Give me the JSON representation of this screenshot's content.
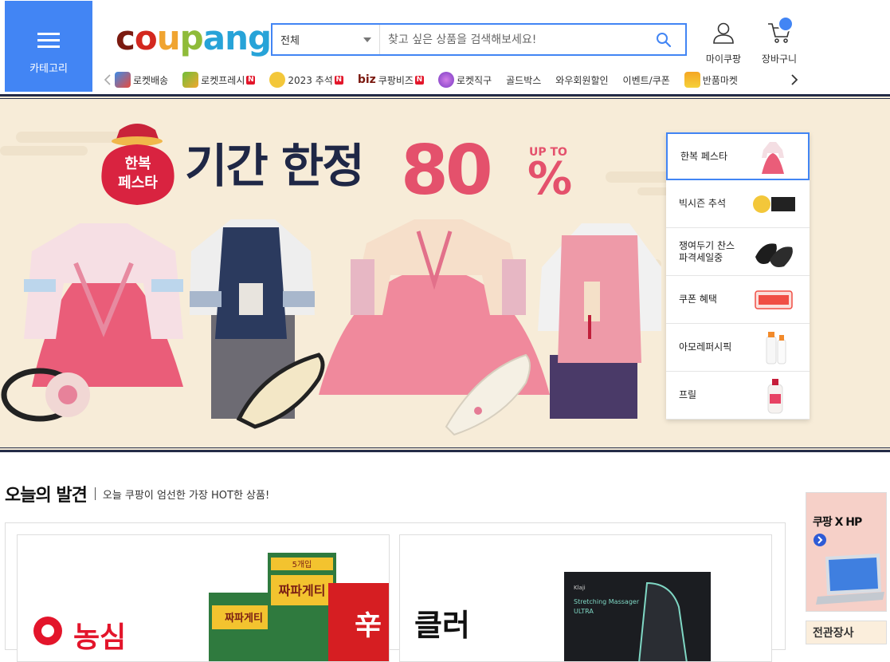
{
  "header": {
    "category_label": "카테고리",
    "logo_letters": [
      "c",
      "o",
      "u",
      "p",
      "ang"
    ],
    "search": {
      "scope": "전체",
      "placeholder": "찾고 싶은 상품을 검색해보세요!"
    },
    "my_coupang": "마이쿠팡",
    "cart": "장바구니"
  },
  "subnav": [
    {
      "label": "로켓배송",
      "icon": "rocket-icon",
      "badge": ""
    },
    {
      "label": "로켓프레시",
      "icon": "rocket-fresh-icon",
      "badge": "N"
    },
    {
      "label": "2023 추석",
      "icon": "chuseok-icon",
      "badge": "N"
    },
    {
      "label": "쿠팡비즈",
      "prefix": "biz",
      "badge": "N"
    },
    {
      "label": "로켓직구",
      "icon": "globe-icon",
      "badge": ""
    },
    {
      "label": "골드박스",
      "badge": ""
    },
    {
      "label": "와우회원할인",
      "badge": ""
    },
    {
      "label": "이벤트/쿠폰",
      "badge": ""
    },
    {
      "label": "반품마켓",
      "icon": "return-market-icon",
      "badge": ""
    }
  ],
  "banner": {
    "pouch_text_1": "한복",
    "pouch_text_2": "페스타",
    "headline": "기간 한정",
    "discount": "80",
    "percent": "%",
    "upto": "UP TO"
  },
  "side_tabs": [
    {
      "label": "한복 페스타",
      "thumb": "hanbok-thumb-icon",
      "active": true
    },
    {
      "label": "빅시즌 추석",
      "thumb": "chuseok-2023-icon",
      "active": false
    },
    {
      "label": "쟁여두기 찬스\n파격세일중",
      "thumb": "slippers-icon",
      "active": false
    },
    {
      "label": "쿠폰 혜택",
      "thumb": "coupon-icon",
      "active": false
    },
    {
      "label": "아모레퍼시픽",
      "thumb": "cosmetics-icon",
      "active": false
    },
    {
      "label": "프릴",
      "thumb": "detergent-icon",
      "active": false
    }
  ],
  "today": {
    "title": "오늘의 발견",
    "subtitle": "오늘 쿠팡이 엄선한 가장 HOT한 상품!"
  },
  "cards": [
    {
      "brand": "농심",
      "pack_text_1": "짜파게티",
      "pack_text_2": "5개입",
      "pack_text_3": "辛"
    },
    {
      "headline": "클러",
      "box_brand": "Klaji",
      "box_title_1": "Stretching Massager",
      "box_title_2": "ULTRA"
    }
  ],
  "ads": [
    {
      "label": "쿠팡 X HP"
    },
    {
      "label": "전관장사"
    }
  ],
  "colors": {
    "accent": "#4285f4",
    "banner_bg": "#f7ecd8",
    "navy": "#242c47",
    "pink": "#ea5d79"
  }
}
